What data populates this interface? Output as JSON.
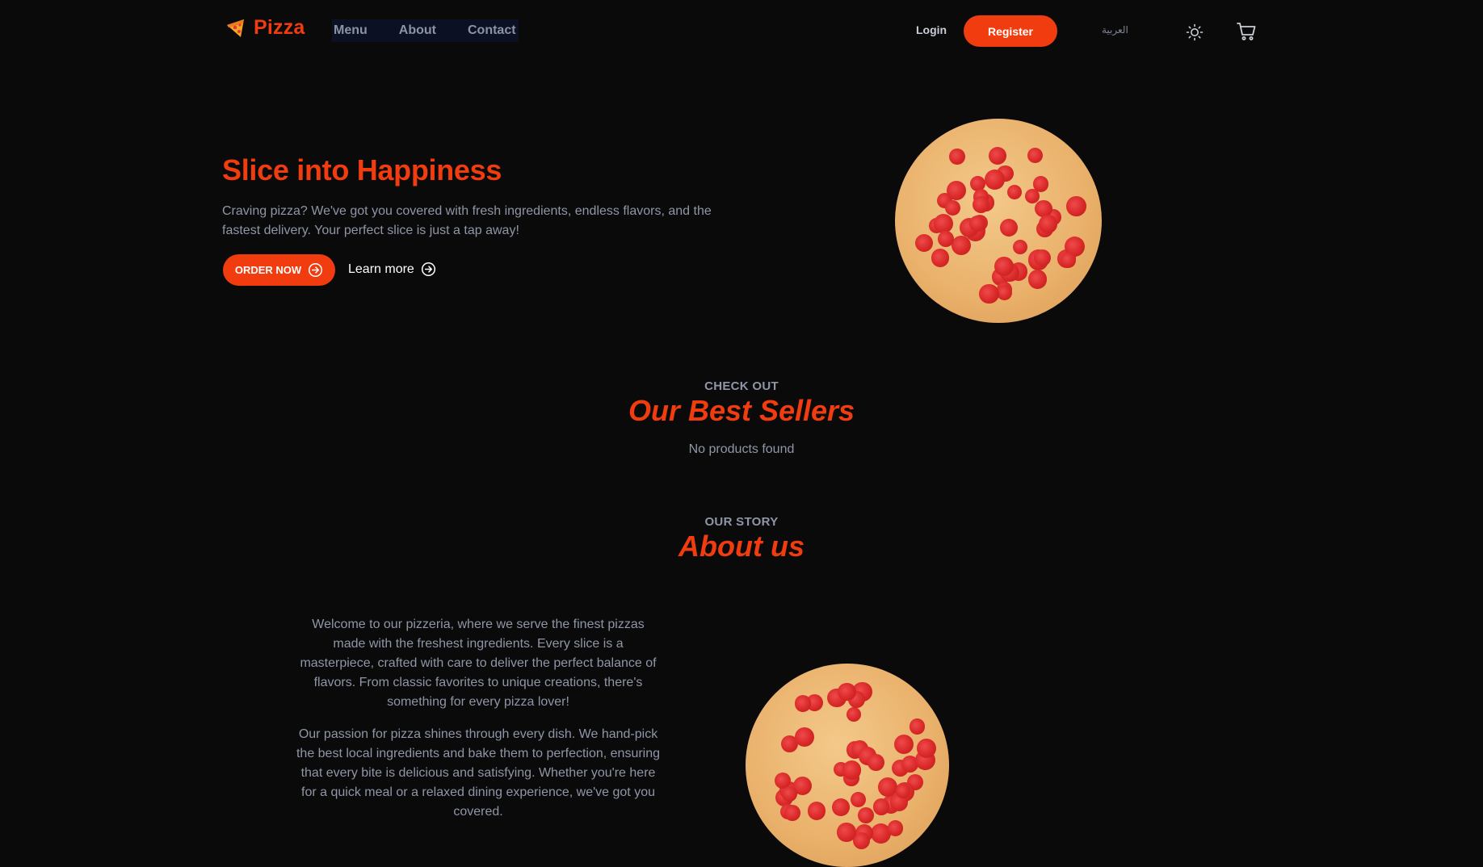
{
  "brand": {
    "name": "Pizza",
    "icon": "pizza-slice-icon",
    "color": "#f03c0f"
  },
  "nav": {
    "items": [
      "Menu",
      "About",
      "Contact"
    ]
  },
  "auth": {
    "login": "Login",
    "register": "Register"
  },
  "language": {
    "label": "العربية"
  },
  "icons": {
    "theme": "sun-icon",
    "cart": "cart-icon",
    "arrow": "arrow-right-circle-icon"
  },
  "hero": {
    "title": "Slice into Happiness",
    "description": "Craving pizza? We've got you covered with fresh ingredients, endless flavors, and the fastest delivery. Your perfect slice is just a tap away!",
    "order_label": "ORDER NOW",
    "learn_label": "Learn more",
    "image": "pepperoni-pizza"
  },
  "best_sellers": {
    "eyebrow": "CHECK OUT",
    "title": "Our Best Sellers",
    "empty_text": "No products found"
  },
  "about": {
    "eyebrow": "OUR STORY",
    "title": "About us",
    "paragraphs": [
      "Welcome to our pizzeria, where we serve the finest pizzas made with the freshest ingredients. Every slice is a masterpiece, crafted with care to deliver the perfect balance of flavors. From classic favorites to unique creations, there's something for every pizza lover!",
      "Our passion for pizza shines through every dish. We hand-pick the best local ingredients and bake them to perfection, ensuring that every bite is delicious and satisfying. Whether you're here for a quick meal or a relaxed dining experience, we've got you covered."
    ],
    "image": "pepperoni-pizza"
  },
  "colors": {
    "accent": "#f03c0f",
    "background": "#0a0a0b",
    "muted_text": "#8f96a6"
  }
}
